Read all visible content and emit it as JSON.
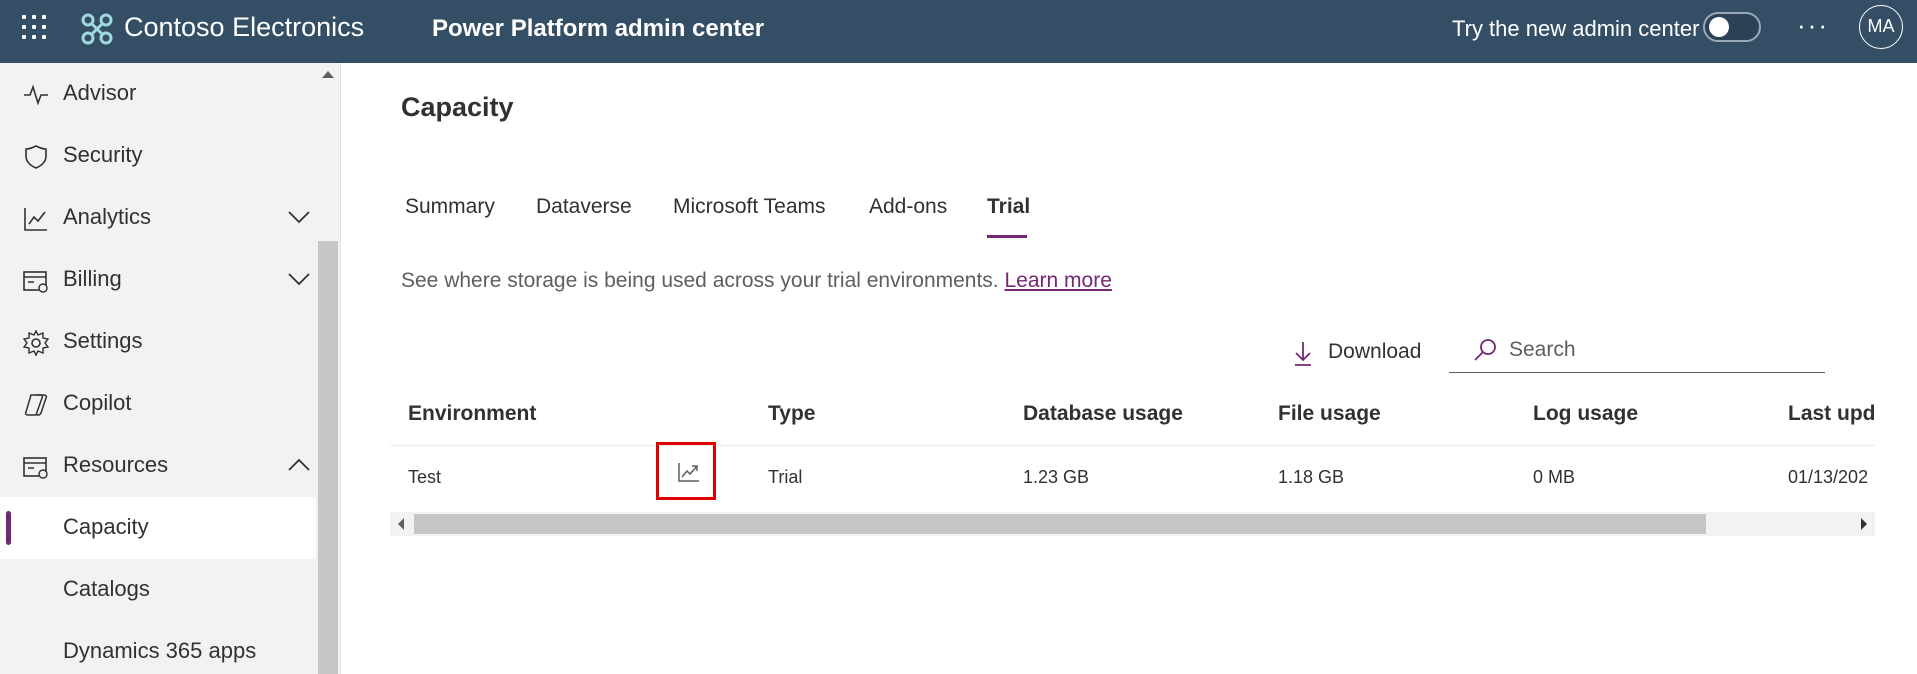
{
  "topbar": {
    "brand": "Contoso Electronics",
    "app_title": "Power Platform admin center",
    "try_new_label": "Try the new admin center",
    "try_new_toggle": "off",
    "more_label": "···",
    "avatar_initials": "MA"
  },
  "sidebar": {
    "items": [
      {
        "label": "Advisor",
        "icon": "pulse-icon"
      },
      {
        "label": "Security",
        "icon": "shield-icon"
      },
      {
        "label": "Analytics",
        "icon": "chart-icon",
        "chevron": "down"
      },
      {
        "label": "Billing",
        "icon": "billing-icon",
        "chevron": "down"
      },
      {
        "label": "Settings",
        "icon": "gear-icon"
      },
      {
        "label": "Copilot",
        "icon": "copilot-icon"
      },
      {
        "label": "Resources",
        "icon": "resources-icon",
        "chevron": "up"
      },
      {
        "label": "Capacity",
        "active": true
      },
      {
        "label": "Catalogs"
      },
      {
        "label": "Dynamics 365 apps"
      }
    ]
  },
  "main": {
    "title": "Capacity",
    "tabs": [
      {
        "label": "Summary"
      },
      {
        "label": "Dataverse"
      },
      {
        "label": "Microsoft Teams"
      },
      {
        "label": "Add-ons"
      },
      {
        "label": "Trial",
        "selected": true
      }
    ],
    "description": "See where storage is being used across your trial environments.",
    "learn_more": "Learn more",
    "download_label": "Download",
    "search_placeholder": "Search",
    "table": {
      "headers": [
        "Environment",
        "Type",
        "Database usage",
        "File usage",
        "Log usage",
        "Last upda"
      ],
      "rows": [
        {
          "environment": "Test",
          "type": "Trial",
          "database_usage": "1.23 GB",
          "file_usage": "1.18 GB",
          "log_usage": "0 MB",
          "last_updated": "01/13/202"
        }
      ]
    }
  },
  "colors": {
    "topbar_bg": "#344e66",
    "accent": "#742774",
    "highlight_box": "#e00000"
  }
}
